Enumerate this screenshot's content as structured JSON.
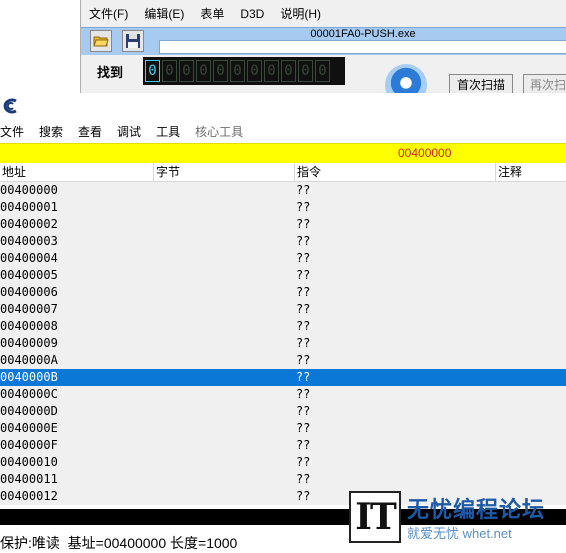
{
  "main_window": {
    "menu": [
      "文件(F)",
      "编辑(E)",
      "表单",
      "D3D",
      "说明(H)"
    ],
    "process_title": "00001FA0-PUSH.exe",
    "found_label": "找到",
    "found_digits": [
      "0",
      "0",
      "0",
      "0",
      "0",
      "0",
      "0",
      "0",
      "0",
      "0",
      "0",
      "0"
    ],
    "first_scan": "首次扫描",
    "next_scan": "再次扫"
  },
  "viewer": {
    "menu": [
      "文件",
      "搜索",
      "查看",
      "调试",
      "工具"
    ],
    "menu_disabled": "核心工具",
    "address_bar": "00400000",
    "columns": [
      "地址",
      "字节",
      "指令",
      "注释"
    ],
    "rows": [
      {
        "addr": "00400000",
        "op": "??"
      },
      {
        "addr": "00400001",
        "op": "??"
      },
      {
        "addr": "00400002",
        "op": "??"
      },
      {
        "addr": "00400003",
        "op": "??"
      },
      {
        "addr": "00400004",
        "op": "??"
      },
      {
        "addr": "00400005",
        "op": "??"
      },
      {
        "addr": "00400006",
        "op": "??"
      },
      {
        "addr": "00400007",
        "op": "??"
      },
      {
        "addr": "00400008",
        "op": "??"
      },
      {
        "addr": "00400009",
        "op": "??"
      },
      {
        "addr": "0040000A",
        "op": "??"
      },
      {
        "addr": "0040000B",
        "op": "??"
      },
      {
        "addr": "0040000C",
        "op": "??"
      },
      {
        "addr": "0040000D",
        "op": "??"
      },
      {
        "addr": "0040000E",
        "op": "??"
      },
      {
        "addr": "0040000F",
        "op": "??"
      },
      {
        "addr": "00400010",
        "op": "??"
      },
      {
        "addr": "00400011",
        "op": "??"
      },
      {
        "addr": "00400012",
        "op": "??"
      }
    ],
    "selected_row": 11,
    "status": "保护:唯读  基址=00400000 长度=1000"
  },
  "watermark": {
    "logo": "IT",
    "title": "无忧编程论坛",
    "subtitle": "就爱无忧 whet.net"
  },
  "colors": {
    "address_bar": "#ffff00",
    "selection": "#0a78d7",
    "toolbar": "#a6caf0"
  }
}
